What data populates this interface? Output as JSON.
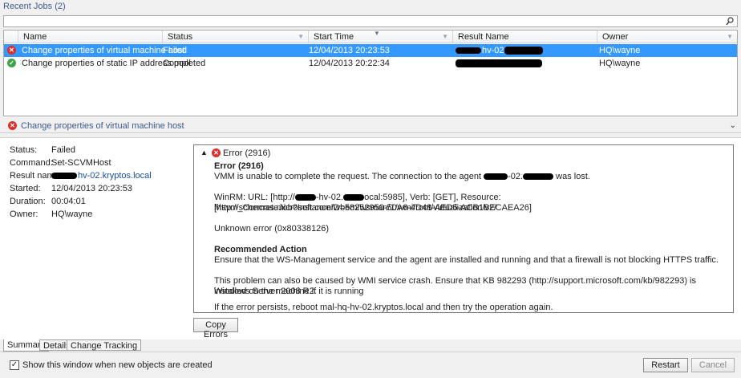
{
  "header": {
    "title": "Recent Jobs (2)"
  },
  "search": {
    "value": ""
  },
  "columns": {
    "name": "Name",
    "status": "Status",
    "start_time": "Start Time",
    "result_name": "Result Name",
    "owner": "Owner"
  },
  "jobs": [
    {
      "name": "Change properties of virtual machine host",
      "status": "Failed",
      "start_time": "12/04/2013 20:23:53",
      "result_fragment": "hv-02.",
      "owner": "HQ\\wayne",
      "state": "error"
    },
    {
      "name": "Change properties of static IP address pool",
      "status": "Completed",
      "start_time": "12/04/2013 20:22:34",
      "result_fragment": "",
      "owner": "HQ\\wayne",
      "state": "ok"
    }
  ],
  "detail": {
    "title": "Change properties of virtual machine host",
    "props": [
      {
        "label": "Status:",
        "value": "Failed"
      },
      {
        "label": "Command:",
        "value": "Set-SCVMHost"
      },
      {
        "label": "Result name:",
        "value": "hv-02.kryptos.local"
      },
      {
        "label": "Started:",
        "value": "12/04/2013 20:23:53"
      },
      {
        "label": "Duration:",
        "value": "00:04:01"
      },
      {
        "label": "Owner:",
        "value": "HQ\\wayne"
      }
    ],
    "error": {
      "header": "Error (2916)",
      "title": "Error (2916)",
      "line1_a": "VMM is unable to complete the request. The connection to the agent",
      "line1_b": "-02.",
      "line1_c": "was lost.",
      "winrm_a": "WinRM: URL: [http://",
      "winrm_b": "-hv-02.",
      "winrm_c": "ocal:5985], Verb: [GET], Resource: [http://schemas.microsoft.com/wbem/wsman/1/wmi/root/virtualization/v2/",
      "winrm_d": "Msvm_ConcreteJob?InstanceID=58252950-50A6-4D48-AED5-ACB1BECAEA26]",
      "unknown": "Unknown error (0x80338126)",
      "rec_title": "Recommended Action",
      "rec_text": "Ensure that the WS-Management service and the agent are installed and running and that a firewall is not blocking HTTPS traffic.",
      "wmi_1": "This problem can also be caused by WMI service crash. Ensure that KB 982293 (http://support.microsoft.com/kb/982293) is installed on the machine if it is running",
      "wmi_2": "Windows Server 2008 R2.",
      "persist": "If the error persists, reboot mal-hq-hv-02.kryptos.local and then try the operation again."
    },
    "copy_errors": "Copy Errors"
  },
  "tabs": [
    "Summary",
    "Details",
    "Change Tracking"
  ],
  "footer": {
    "show_window_label": "Show this window when new objects are created",
    "show_window_checked": true,
    "restart": "Restart",
    "cancel": "Cancel"
  }
}
